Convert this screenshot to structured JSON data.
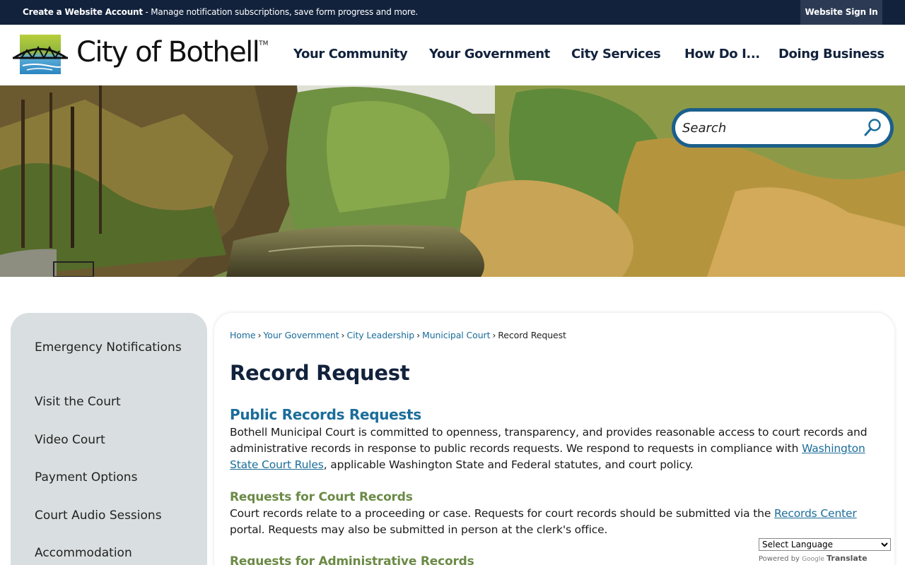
{
  "topbar": {
    "account_link": "Create a Website Account",
    "account_text": " - Manage notification subscriptions, save form progress and more.",
    "signin_label": "Website Sign In"
  },
  "header": {
    "logo_text": "City of Bothell",
    "logo_tm": "TM",
    "nav": [
      "Your Community",
      "Your Government",
      "City Services",
      "How Do I...",
      "Doing Business"
    ]
  },
  "search": {
    "placeholder": "Search",
    "icon": "search-icon"
  },
  "sidebar": {
    "items": [
      {
        "label": "Emergency Notifications"
      },
      {
        "label": "Visit the Court"
      },
      {
        "label": "Video Court"
      },
      {
        "label": "Payment Options"
      },
      {
        "label": "Court Audio Sessions"
      },
      {
        "label": "Accommodation"
      }
    ]
  },
  "breadcrumb": {
    "items": [
      "Home",
      "Your Government",
      "City Leadership",
      "Municipal Court"
    ],
    "current": "Record Request",
    "separator": "›"
  },
  "main": {
    "title": "Record Request",
    "section1": {
      "heading": "Public Records Requests",
      "text_before": "Bothell Municipal Court is committed to openness, transparency, and provides reasonable access to court records and administrative records in response to public records requests. We respond to requests in compliance with ",
      "link": "Washington State Court Rules",
      "text_after": ", applicable Washington State and Federal statutes, and court policy."
    },
    "section2": {
      "heading": "Requests for Court Records",
      "text_before": "Court records relate to a proceeding or case. Requests for court records should be submitted via the ",
      "link": "Records Center",
      "text_after": " portal. Requests may also be submitted in person at the clerk's office."
    },
    "section3": {
      "heading": "Requests for Administrative Records"
    }
  },
  "translate": {
    "select_label": "Select Language",
    "powered_by": "Powered by",
    "google": "Google",
    "translate": "Translate"
  },
  "colors": {
    "topbar": "#12223c",
    "accent_blue": "#1b6d9a",
    "subheading_green": "#6b8a46",
    "sidebar_bg": "#d9dfe0"
  }
}
